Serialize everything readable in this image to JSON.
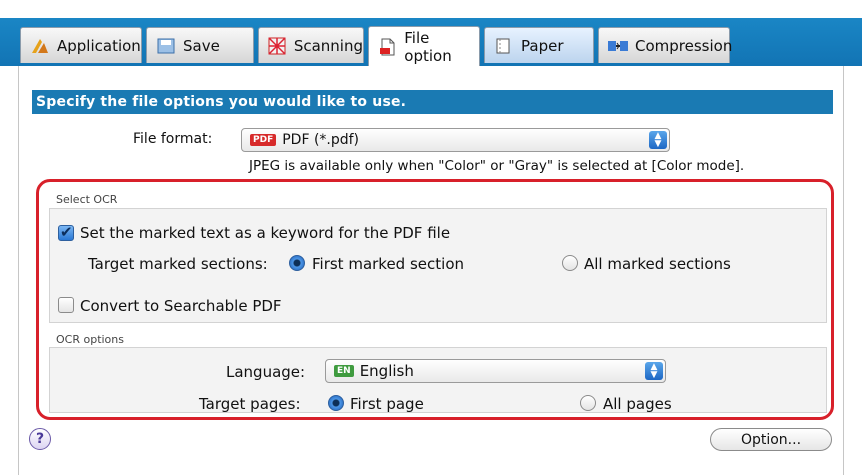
{
  "tabs": [
    {
      "label": "Application",
      "icon": "application-icon"
    },
    {
      "label": "Save",
      "icon": "save-icon"
    },
    {
      "label": "Scanning",
      "icon": "scanning-icon"
    },
    {
      "label": "File option",
      "icon": "file-option-icon",
      "active": true
    },
    {
      "label": "Paper",
      "icon": "paper-icon"
    },
    {
      "label": "Compression",
      "icon": "compression-icon"
    }
  ],
  "header": {
    "text": "Specify the file options you would like to use."
  },
  "file_format": {
    "label": "File format:",
    "badge": "PDF",
    "value": "PDF (*.pdf)",
    "note": "JPEG is available only when \"Color\" or \"Gray\" is selected at [Color mode]."
  },
  "select_ocr": {
    "title": "Select OCR",
    "keyword_checkbox": {
      "label": "Set the marked text as a keyword for the PDF file",
      "checked": true
    },
    "target_sections_label": "Target marked sections:",
    "first_marked": {
      "label": "First marked section",
      "selected": true
    },
    "all_marked": {
      "label": "All marked sections",
      "selected": false
    },
    "searchable_checkbox": {
      "label": "Convert to Searchable PDF",
      "checked": false
    }
  },
  "ocr_options": {
    "title": "OCR options",
    "language_label": "Language:",
    "language_badge": "EN",
    "language_value": "English",
    "target_pages_label": "Target pages:",
    "first_page": {
      "label": "First page",
      "selected": true
    },
    "all_pages": {
      "label": "All pages",
      "selected": false
    }
  },
  "footer": {
    "help": "?",
    "option_button": "Option..."
  },
  "colors": {
    "accent_blue": "#1a7ab3",
    "highlight_red": "#d8202a"
  }
}
